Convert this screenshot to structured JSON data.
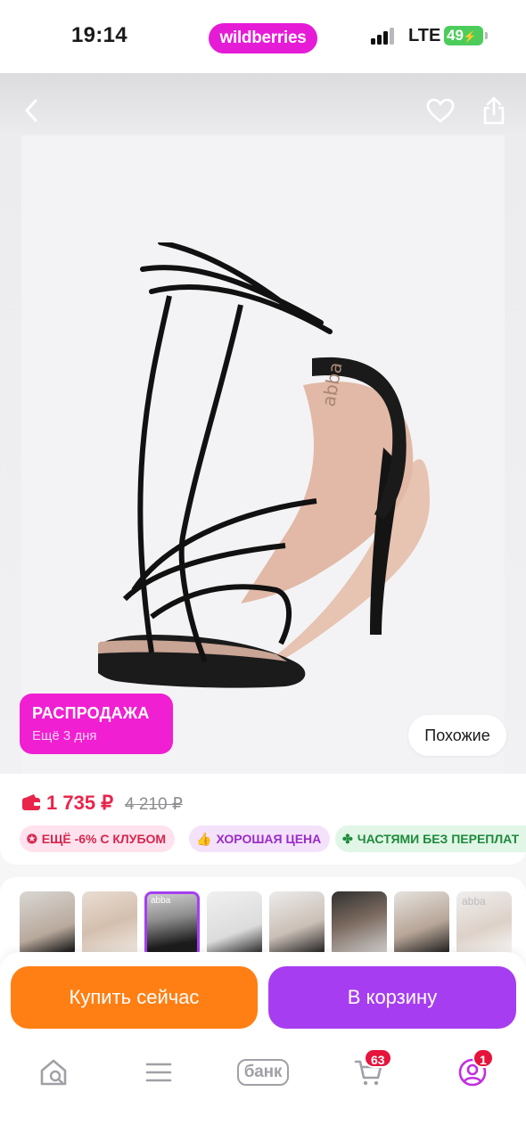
{
  "status_bar": {
    "time": "19:14",
    "store_label": "wildberries",
    "network": "LTE",
    "battery": "49"
  },
  "product": {
    "sale_title": "РАСПРОДАЖА",
    "sale_subtitle": "Ещё 3 дня",
    "similar_label": "Похожие",
    "price": "1 735 ₽",
    "old_price": "4 210 ₽",
    "shoe_brand_mark": "abba",
    "chips": [
      {
        "icon": "club-star-icon",
        "label": "ЕЩЁ -6% С КЛУБОМ"
      },
      {
        "icon": "thumbs-up-icon",
        "label": "ХОРОШАЯ ЦЕНА"
      },
      {
        "icon": "clover-icon",
        "label": "ЧАСТЯМИ БЕЗ ПЕРЕПЛАТ"
      }
    ],
    "thumbnails": [
      {
        "active": false
      },
      {
        "active": false
      },
      {
        "active": true,
        "label": "abba"
      },
      {
        "active": false
      },
      {
        "active": false
      },
      {
        "active": false
      },
      {
        "active": false
      },
      {
        "active": false,
        "label": "abba"
      }
    ]
  },
  "actions": {
    "buy_now": "Купить сейчас",
    "add_to_cart": "В корзину"
  },
  "tabbar": {
    "bank_label": "банк",
    "cart_count": "63",
    "profile_count": "1"
  },
  "colors": {
    "brand": "#e51bd6",
    "sale": "#f01fd1",
    "price": "#e8254a",
    "buy": "#ff7f14",
    "cart": "#a73df1"
  }
}
